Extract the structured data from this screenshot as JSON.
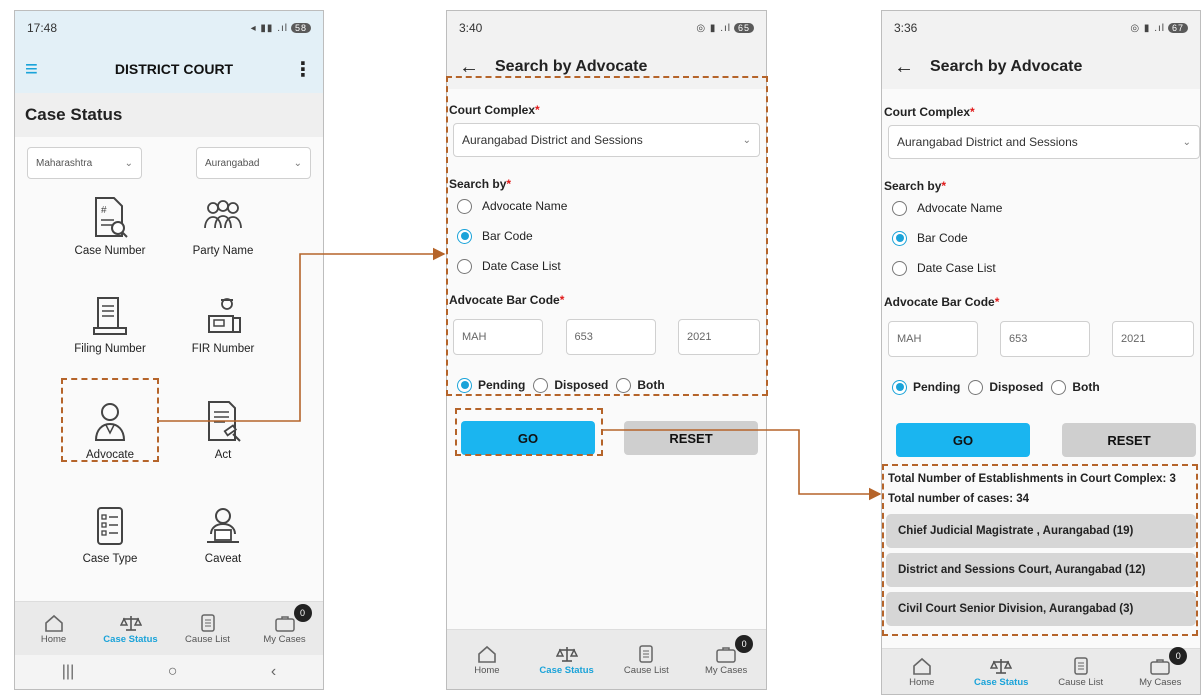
{
  "screen1": {
    "status_time": "17:48",
    "battery": "58",
    "app_title": "DISTRICT COURT",
    "section_title": "Case Status",
    "state_select": "Maharashtra",
    "district_select": "Aurangabad",
    "tiles": [
      "Case Number",
      "Party Name",
      "Filing Number",
      "FIR Number",
      "Advocate",
      "Act",
      "Case Type",
      "Caveat"
    ],
    "nav": [
      "Home",
      "Case Status",
      "Cause List",
      "My Cases"
    ],
    "badge": "0"
  },
  "screen2": {
    "status_time": "3:40",
    "battery": "65",
    "title": "Search by Advocate",
    "court_complex_label": "Court Complex",
    "court_complex_value": "Aurangabad District and Sessions",
    "search_by_label": "Search by",
    "options": [
      "Advocate Name",
      "Bar Code",
      "Date Case List"
    ],
    "bar_code_label": "Advocate Bar Code",
    "bar_code_values": [
      "MAH",
      "653",
      "2021"
    ],
    "status_options": [
      "Pending",
      "Disposed",
      "Both"
    ],
    "go_label": "GO",
    "reset_label": "RESET",
    "nav": [
      "Home",
      "Case Status",
      "Cause List",
      "My Cases"
    ],
    "badge": "0"
  },
  "screen3": {
    "status_time": "3:36",
    "battery": "67",
    "title": "Search by Advocate",
    "court_complex_label": "Court Complex",
    "court_complex_value": "Aurangabad District and Sessions",
    "search_by_label": "Search by",
    "options": [
      "Advocate Name",
      "Bar Code",
      "Date Case List"
    ],
    "bar_code_label": "Advocate Bar Code",
    "bar_code_values": [
      "MAH",
      "653",
      "2021"
    ],
    "status_options": [
      "Pending",
      "Disposed",
      "Both"
    ],
    "go_label": "GO",
    "reset_label": "RESET",
    "total_establishments": "Total Number of Establishments in Court Complex: 3",
    "total_cases": "Total number of cases: 34",
    "results": [
      "Chief Judicial Magistrate , Aurangabad (19)",
      "District  and Sessions Court, Aurangabad (12)",
      "Civil  Court Senior Division, Aurangabad (3)"
    ],
    "nav": [
      "Home",
      "Case Status",
      "Cause List",
      "My Cases"
    ],
    "badge": "0"
  },
  "colors": {
    "accent": "#1ab5f0",
    "highlight": "#b5642a",
    "required": "#e01a1a"
  }
}
